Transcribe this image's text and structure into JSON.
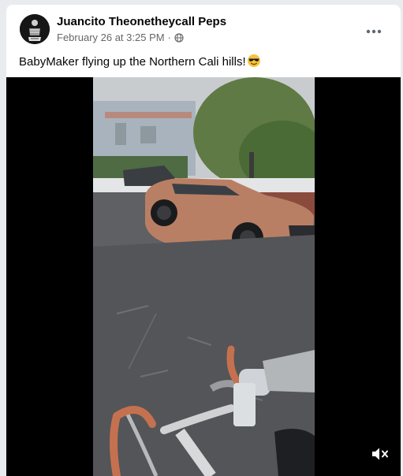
{
  "post": {
    "author_name": "Juancito Theonetheycall Peps",
    "timestamp": "February 26 at 3:25 PM",
    "separator": "·",
    "audience_icon": "globe-icon",
    "caption_text": "BabyMaker flying up the Northern Cali hills!",
    "caption_emoji": "smiling-face-with-sunglasses-emoji",
    "more_options_icon": "more-horizontal-icon"
  },
  "video": {
    "mute_icon": "volume-muted-icon"
  },
  "colors": {
    "name_text": "#050505",
    "meta_text": "#65676b",
    "video_background": "#000000",
    "car": "#b97f64"
  }
}
